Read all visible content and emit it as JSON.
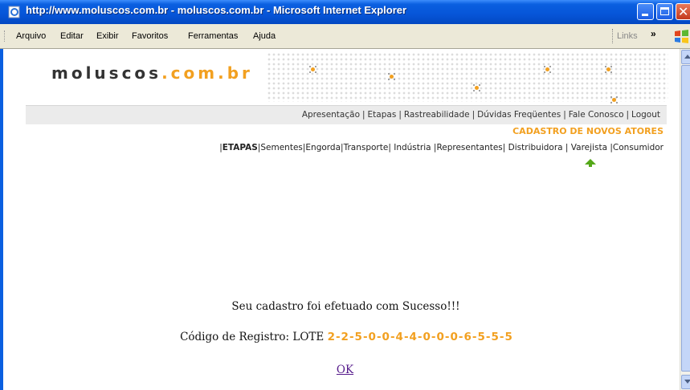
{
  "window": {
    "title": "http://www.moluscos.com.br - moluscos.com.br - Microsoft Internet Explorer",
    "close_glyph": "✕"
  },
  "menu": {
    "items": [
      "Arquivo",
      "Editar",
      "Exibir",
      "Favoritos",
      "Ferramentas",
      "Ajuda"
    ],
    "links_label": "Links",
    "chevron": "»"
  },
  "site": {
    "logo_part1": "moluscos",
    "logo_part2": ".com.br"
  },
  "nav": {
    "items": [
      "Apresentação",
      "Etapas",
      "Rastreabilidade",
      "Dúvidas Freqüentes",
      "Fale Conosco",
      "Logout"
    ]
  },
  "cadastro_title": "CADASTRO DE NOVOS ATORES",
  "etapas": {
    "current": "ETAPAS",
    "items": [
      "Sementes",
      "Engorda",
      "Transporte",
      "Indústria",
      "Representantes",
      "Distribuidora",
      "Varejista",
      "Consumidor"
    ]
  },
  "result": {
    "message": "Seu cadastro foi efetuado com Sucesso!!!",
    "code_label": "Código de Registro: LOTE ",
    "code_value": "2-2-5-0-0-4-4-0-0-0-6-5-5-5",
    "ok_label": "OK"
  },
  "colors": {
    "accent_orange": "#f2a020",
    "arrow_green": "#54a818",
    "titlebar_blue": "#0a5fe0"
  }
}
